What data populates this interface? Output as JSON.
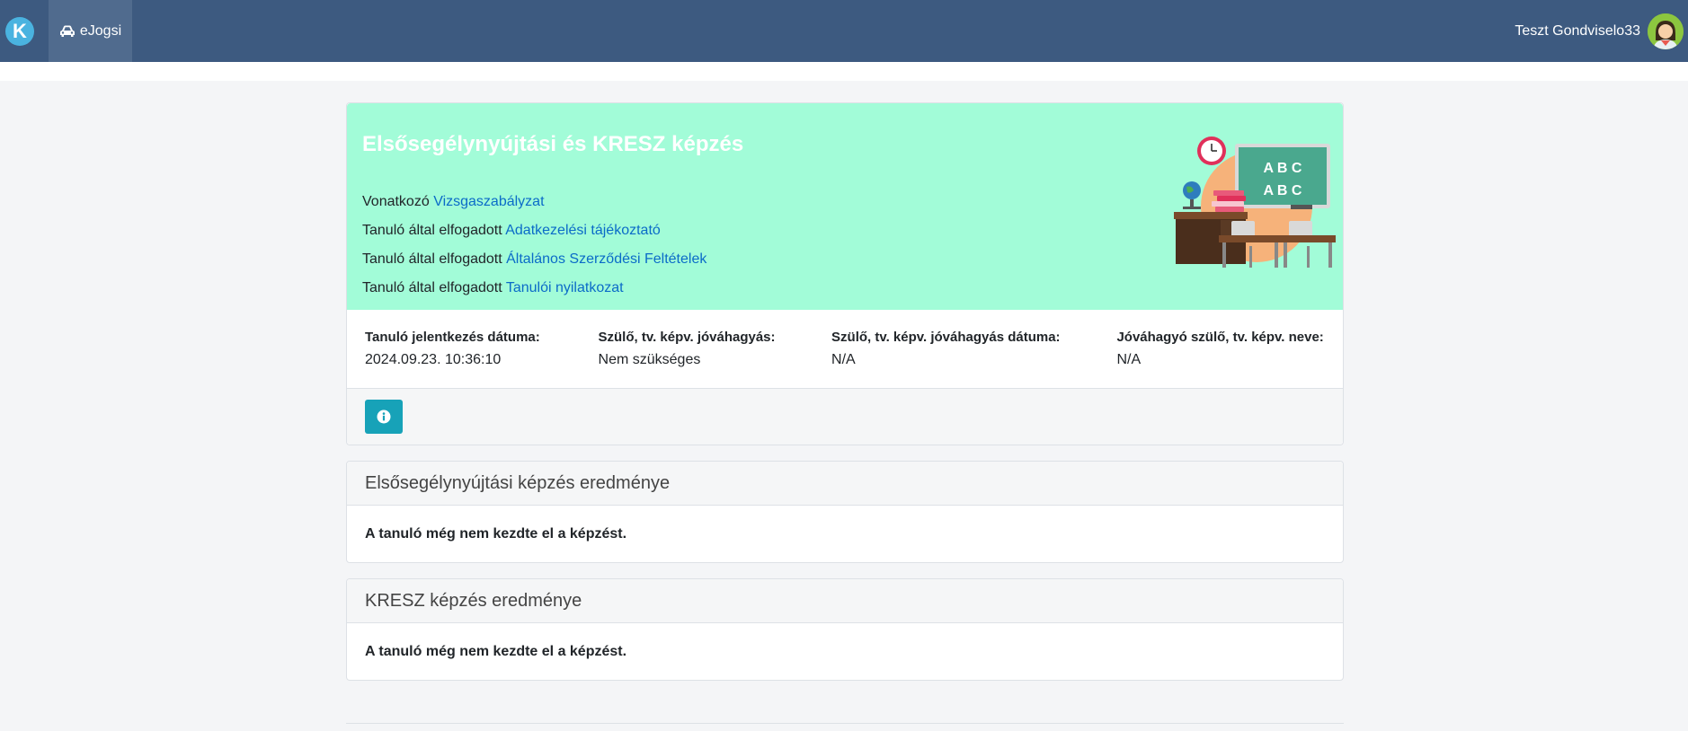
{
  "navbar": {
    "logo_letter": "K",
    "app_label": "eJogsi",
    "app_icon": "car-icon",
    "user_name": "Teszt Gondviselo33"
  },
  "hero": {
    "title": "Elsősegélynyújtási és KRESZ képzés",
    "lines": [
      {
        "prefix": "Vonatkozó",
        "link": "Vizsgaszabályzat"
      },
      {
        "prefix": "Tanuló által elfogadott",
        "link": "Adatkezelési tájékoztató"
      },
      {
        "prefix": "Tanuló által elfogadott",
        "link": "Általános Szerződési Feltételek"
      },
      {
        "prefix": "Tanuló által elfogadott",
        "link": "Tanulói nyilatkozat"
      }
    ],
    "board_text": [
      "A B C",
      "A B C"
    ]
  },
  "info": [
    {
      "label": "Tanuló jelentkezés dátuma:",
      "value": "2024.09.23. 10:36:10"
    },
    {
      "label": "Szülő, tv. képv. jóváhagyás:",
      "value": "Nem szükséges"
    },
    {
      "label": "Szülő, tv. képv. jóváhagyás dátuma:",
      "value": "N/A"
    },
    {
      "label": "Jóváhagyó szülő, tv. képv. neve:",
      "value": "N/A"
    }
  ],
  "results": [
    {
      "title": "Elsősegélynyújtási képzés eredménye",
      "body": "A tanuló még nem kezdte el a képzést."
    },
    {
      "title": "KRESZ képzés eredménye",
      "body": "A tanuló még nem kezdte el a képzést."
    }
  ],
  "colors": {
    "navbar": "#3d5a80",
    "hero_bg": "#a2fcd8",
    "link": "#0b6bc8",
    "info_button": "#17a2b8"
  }
}
